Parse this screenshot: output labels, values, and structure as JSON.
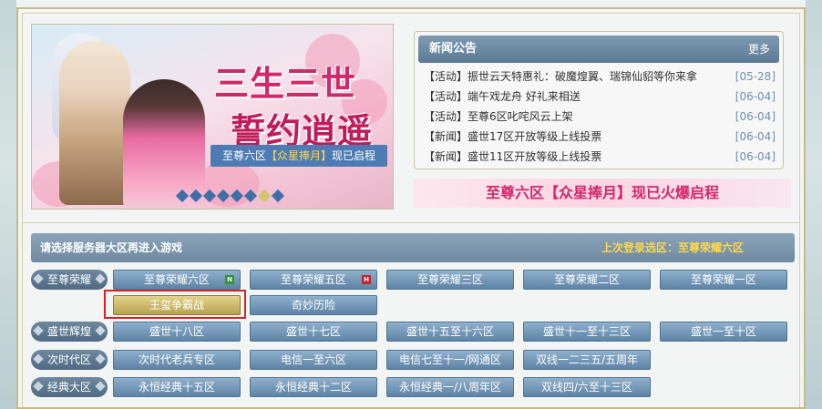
{
  "banner": {
    "title_line1": "三生三世",
    "title_line2": "誓约逍遥",
    "ribbon_prefix": "至尊六区",
    "ribbon_highlight": "【众星捧月】",
    "ribbon_suffix": "现已启程",
    "slide_count": 8,
    "active_slide": 6
  },
  "news": {
    "title": "新闻公告",
    "more": "更多",
    "items": [
      {
        "text": "【活动】振世云天特惠礼：破魔煌翼、瑞锦仙貂等你来拿",
        "date": "[05-28]"
      },
      {
        "text": "【活动】端午戏龙舟 好礼来相送",
        "date": "[06-04]"
      },
      {
        "text": "【活动】至尊6区叱咤风云上架",
        "date": "[06-04]"
      },
      {
        "text": "【新闻】盛世17区开放等级上线投票",
        "date": "[06-04]"
      },
      {
        "text": "【新闻】盛世11区开放等级上线投票",
        "date": "[06-04]"
      }
    ],
    "banner_text": "至尊六区【众星捧月】现已火爆启程"
  },
  "servers": {
    "hint": "请选择服务器大区再进入游戏",
    "last_label": "上次登录选区：",
    "last_value": "至尊荣耀六区",
    "groups": [
      {
        "category": "至尊荣耀",
        "rows": [
          [
            {
              "name": "至尊荣耀六区",
              "badge": "N"
            },
            {
              "name": "至尊荣耀五区",
              "badge": "H"
            },
            {
              "name": "至尊荣耀三区",
              "badge": ""
            },
            {
              "name": "至尊荣耀二区",
              "badge": ""
            },
            {
              "name": "至尊荣耀一区",
              "badge": ""
            }
          ],
          [
            {
              "name": "王玺争霸战",
              "badge": "",
              "style": "gold"
            },
            {
              "name": "奇妙历险",
              "badge": ""
            }
          ]
        ]
      },
      {
        "category": "盛世辉煌",
        "rows": [
          [
            {
              "name": "盛世十八区",
              "badge": ""
            },
            {
              "name": "盛世十七区",
              "badge": ""
            },
            {
              "name": "盛世十五至十六区",
              "badge": ""
            },
            {
              "name": "盛世十一至十三区",
              "badge": ""
            },
            {
              "name": "盛世一至十区",
              "badge": ""
            }
          ]
        ]
      },
      {
        "category": "次时代区",
        "rows": [
          [
            {
              "name": "次时代老兵专区",
              "badge": ""
            },
            {
              "name": "电信一至六区",
              "badge": ""
            },
            {
              "name": "电信七至十一/网通区",
              "badge": ""
            },
            {
              "name": "双线一二三五/五周年",
              "badge": ""
            }
          ]
        ]
      },
      {
        "category": "经典大区",
        "rows": [
          [
            {
              "name": "永恒经典十五区",
              "badge": ""
            },
            {
              "name": "永恒经典十二区",
              "badge": ""
            },
            {
              "name": "永恒经典一/八周年区",
              "badge": ""
            },
            {
              "name": "双线四/六至十三区",
              "badge": ""
            }
          ]
        ]
      }
    ]
  }
}
